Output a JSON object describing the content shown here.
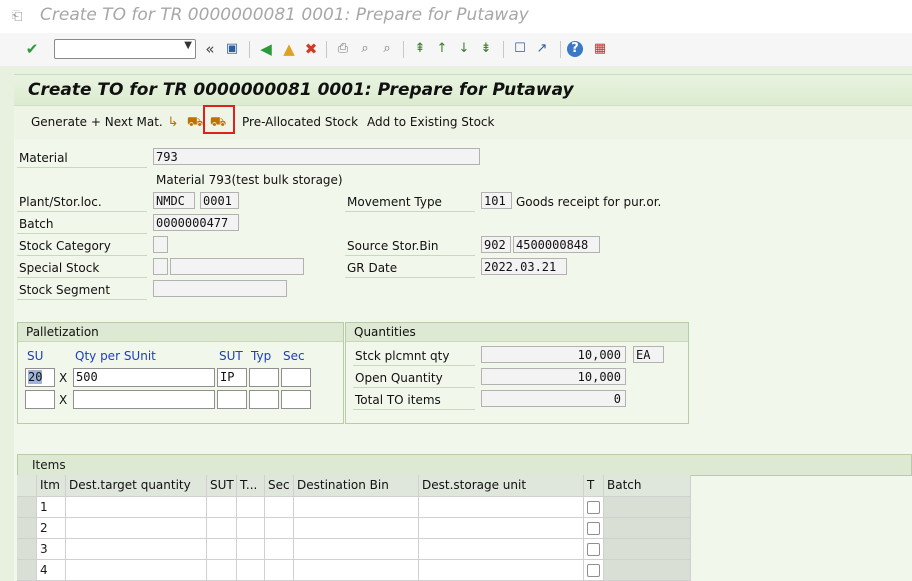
{
  "window": {
    "title": "Create TO for TR 0000000081 0001: Prepare for Putaway"
  },
  "toolbar": {
    "command_field_value": "",
    "icons": [
      "enter-icon",
      "back-icon",
      "save-icon",
      "back-nav-icon",
      "exit-icon",
      "cancel-icon",
      "print-icon",
      "find-icon",
      "find-next-icon",
      "first-page-icon",
      "prev-page-icon",
      "next-page-icon",
      "last-page-icon",
      "new-session-icon",
      "shortcut-icon",
      "help-icon",
      "customize-icon"
    ],
    "colors": {
      "accent_green": "#2a9a3a",
      "cancel_red": "#d23a26"
    }
  },
  "header": {
    "title": "Create TO for TR 0000000081 0001: Prepare for Putaway"
  },
  "app_toolbar": {
    "generate_next": "Generate + Next Mat.",
    "pre_allocated": "Pre-Allocated Stock",
    "add_existing": "Add to Existing Stock",
    "highlight_color": "#e0201d"
  },
  "fields": {
    "material_label": "Material",
    "material_value": "793",
    "material_desc": "Material 793(test bulk storage)",
    "plant_label": "Plant/Stor.loc.",
    "plant_value": "NMDC",
    "storloc_value": "0001",
    "movement_type_label": "Movement Type",
    "movement_type_value": "101",
    "movement_type_desc": "Goods receipt for pur.or.",
    "batch_label": "Batch",
    "batch_value": "0000000477",
    "stock_category_label": "Stock Category",
    "stock_category_value": "",
    "source_bin_label": "Source Stor.Bin",
    "source_bin_type": "902",
    "source_bin_value": "4500000848",
    "special_stock_label": "Special Stock",
    "special_stock_value": "",
    "special_stock_num": "",
    "gr_date_label": "GR Date",
    "gr_date_value": "2022.03.21",
    "stock_segment_label": "Stock Segment",
    "stock_segment_value": ""
  },
  "palletization": {
    "title": "Palletization",
    "col_su": "SU",
    "col_qty": "Qty per SUnit",
    "col_sut": "SUT",
    "col_typ": "Typ",
    "col_sec": "Sec",
    "rows": [
      {
        "su": "20",
        "x": "X",
        "qty": "500",
        "sut": "IP",
        "typ": "",
        "sec": ""
      },
      {
        "su": "",
        "x": "X",
        "qty": "",
        "sut": "",
        "typ": "",
        "sec": ""
      }
    ]
  },
  "quantities": {
    "title": "Quantities",
    "stock_placement_label": "Stck plcmnt qty",
    "stock_placement_value": "10,000",
    "unit": "EA",
    "open_qty_label": "Open Quantity",
    "open_qty_value": "10,000",
    "total_to_label": "Total TO items",
    "total_to_value": "0"
  },
  "items": {
    "title": "Items",
    "columns": [
      "Itm",
      "Dest.target quantity",
      "SUT",
      "T...",
      "Sec",
      "Destination Bin",
      "Dest.storage unit",
      "T",
      "Batch"
    ],
    "rows": [
      {
        "itm": "1"
      },
      {
        "itm": "2"
      },
      {
        "itm": "3"
      },
      {
        "itm": "4"
      }
    ]
  }
}
